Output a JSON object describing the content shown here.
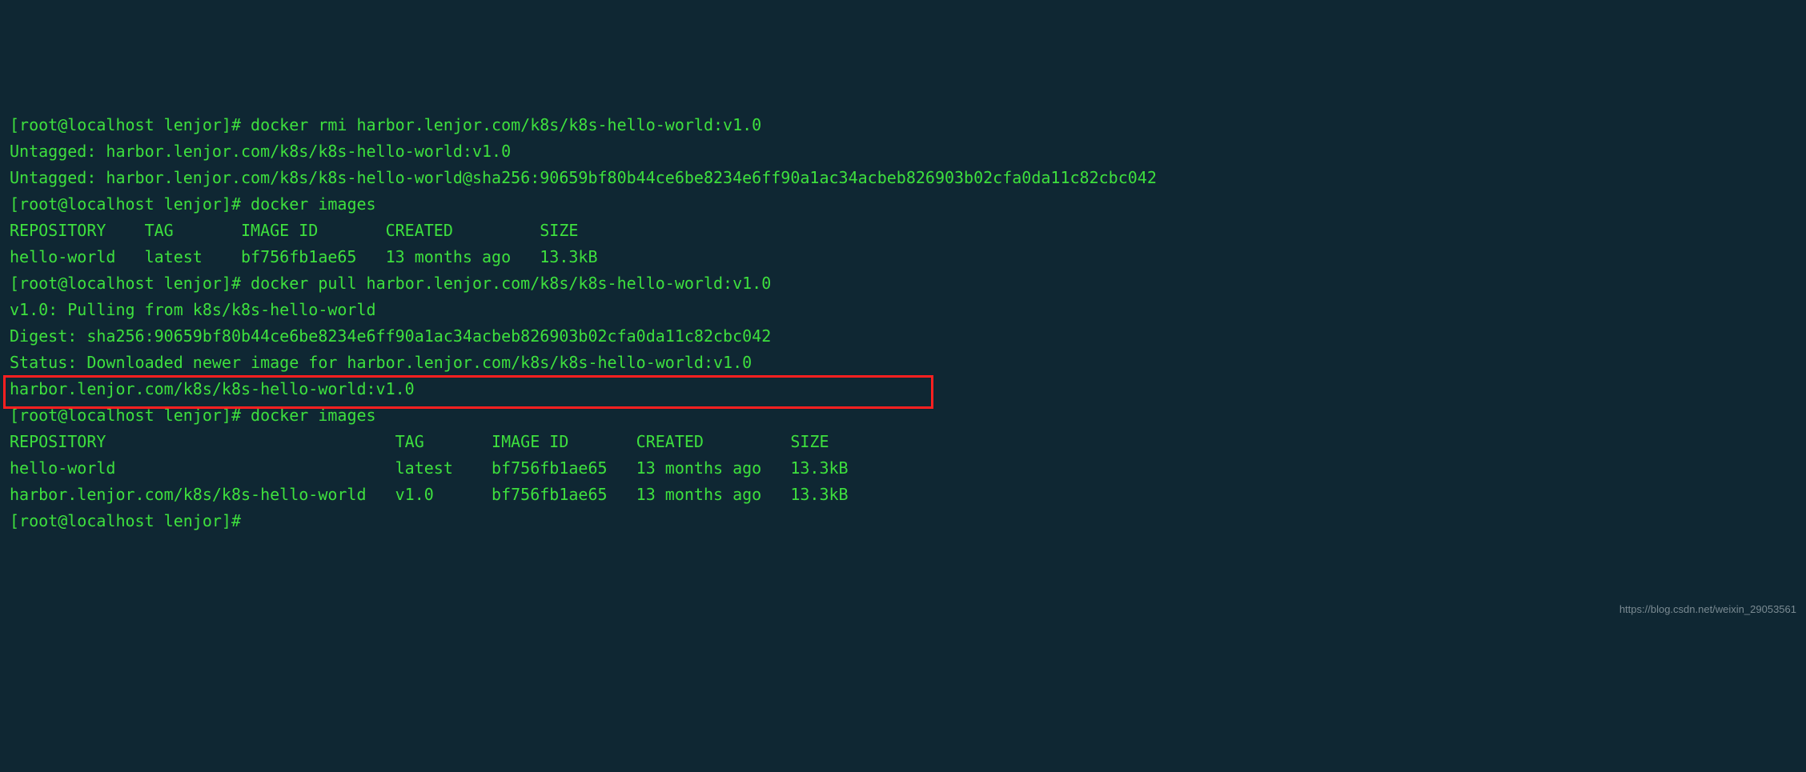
{
  "prompt1": "[root@localhost lenjor]# ",
  "cmd1": "docker rmi harbor.lenjor.com/k8s/k8s-hello-world:v1.0",
  "out1": "Untagged: harbor.lenjor.com/k8s/k8s-hello-world:v1.0",
  "out2": "Untagged: harbor.lenjor.com/k8s/k8s-hello-world@sha256:90659bf80b44ce6be8234e6ff90a1ac34acbeb826903b02cfa0da11c82cbc042",
  "prompt2": "[root@localhost lenjor]# ",
  "cmd2": "docker images",
  "out3": "REPOSITORY    TAG       IMAGE ID       CREATED         SIZE",
  "out4": "hello-world   latest    bf756fb1ae65   13 months ago   13.3kB",
  "prompt3": "[root@localhost lenjor]# ",
  "cmd3": "docker pull harbor.lenjor.com/k8s/k8s-hello-world:v1.0",
  "out5": "v1.0: Pulling from k8s/k8s-hello-world",
  "out6": "Digest: sha256:90659bf80b44ce6be8234e6ff90a1ac34acbeb826903b02cfa0da11c82cbc042",
  "out7": "Status: Downloaded newer image for harbor.lenjor.com/k8s/k8s-hello-world:v1.0",
  "out8": "harbor.lenjor.com/k8s/k8s-hello-world:v1.0",
  "prompt4": "[root@localhost lenjor]# ",
  "cmd4": "docker images",
  "out9": "REPOSITORY                              TAG       IMAGE ID       CREATED         SIZE",
  "out10": "hello-world                             latest    bf756fb1ae65   13 months ago   13.3kB",
  "out11": "harbor.lenjor.com/k8s/k8s-hello-world   v1.0      bf756fb1ae65   13 months ago   13.3kB",
  "prompt5": "[root@localhost lenjor]# ",
  "watermark": "https://blog.csdn.net/weixin_29053561"
}
